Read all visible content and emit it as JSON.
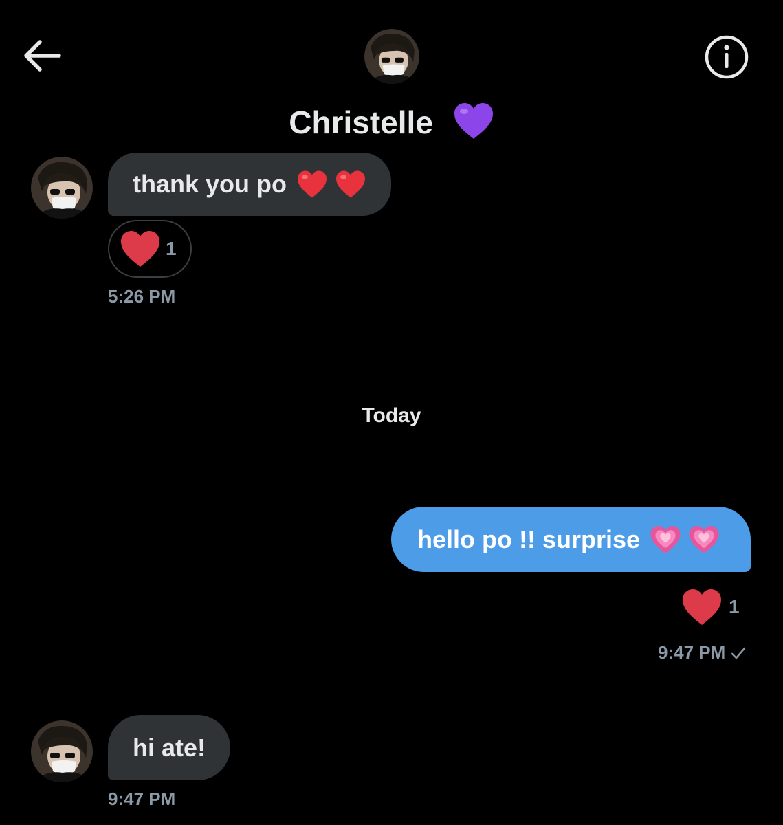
{
  "header": {
    "contact_name": "Christelle",
    "name_emoji": "purple-heart",
    "back_icon": "arrow-left-icon",
    "info_icon": "info-circle-icon"
  },
  "colors": {
    "background": "#000000",
    "incoming_bubble": "#2f3336",
    "outgoing_bubble": "#4d9ce8",
    "muted_text": "#8b98a5",
    "reaction_heart": "#dd3b4a"
  },
  "messages": [
    {
      "direction": "incoming",
      "text": "thank you po",
      "emojis": [
        "red-heart",
        "red-heart"
      ],
      "reaction": {
        "emoji": "red-heart",
        "count": "1"
      },
      "time": "5:26 PM"
    },
    {
      "direction": "separator",
      "text": "Today"
    },
    {
      "direction": "outgoing",
      "text": "hello po !! surprise",
      "emojis": [
        "growing-heart",
        "growing-heart"
      ],
      "reaction": {
        "emoji": "red-heart",
        "count": "1"
      },
      "time": "9:47 PM",
      "status_icon": "check-icon"
    },
    {
      "direction": "incoming",
      "text": "hi ate!",
      "emojis": [],
      "time": "9:47 PM"
    }
  ]
}
